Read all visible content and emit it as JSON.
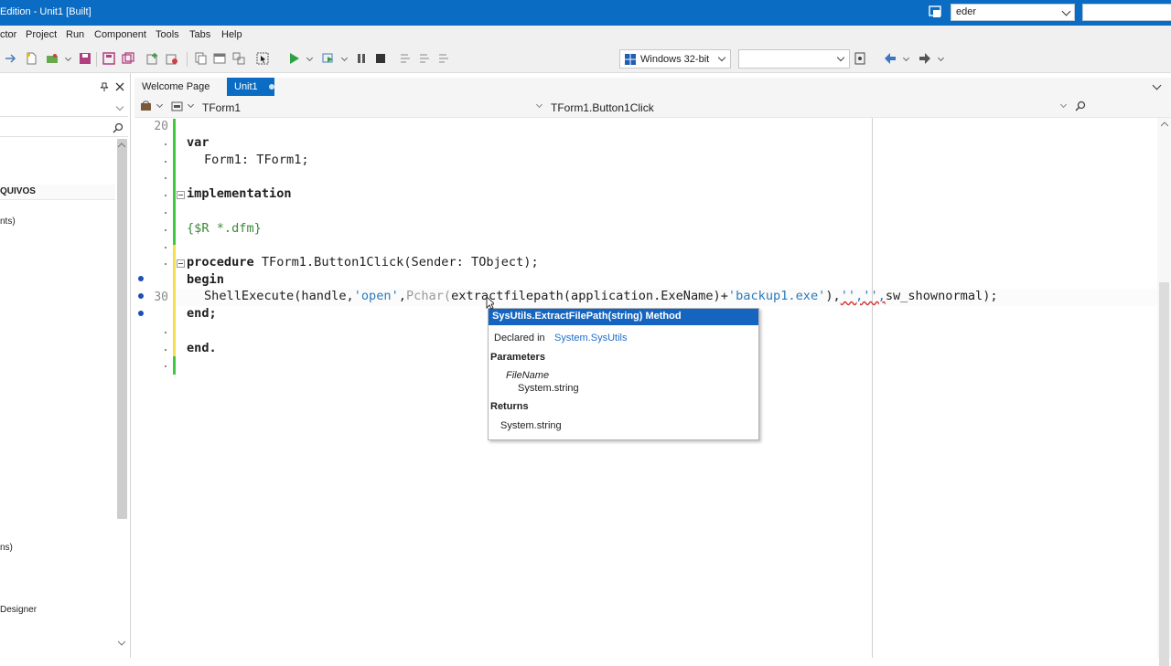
{
  "window": {
    "title": "Edition - Unit1 [Built]",
    "user_combo": "eder",
    "right_combo": ""
  },
  "menu": [
    "ctor",
    "Project",
    "Run",
    "Component",
    "Tools",
    "Tabs",
    "Help"
  ],
  "toolbar": {
    "platform": "Windows 32-bit",
    "config": ""
  },
  "left_panel": {
    "items": [
      "QUIVOS",
      "nts)",
      "ns)",
      "Designer"
    ]
  },
  "tabs": [
    {
      "label": "Welcome Page",
      "active": false
    },
    {
      "label": "Unit1",
      "active": true,
      "modified": true
    }
  ],
  "navigator": {
    "class": "TForm1",
    "method": "TForm1.Button1Click"
  },
  "editor": {
    "line_20": "20",
    "line_30": "30",
    "l_var": "var",
    "l_form1": "Form1: TForm1;",
    "l_impl": "implementation",
    "l_res": "{$R *.dfm}",
    "l_proc_kw": "procedure",
    "l_proc_rest": " TForm1.Button1Click(Sender: TObject);",
    "l_begin": "begin",
    "l_shell_a": "ShellExecute(handle,",
    "l_shell_open": "'open'",
    "l_shell_b": ",",
    "l_shell_pchar": "Pchar(",
    "l_shell_c": "extractfilepath(application.ExeName)+",
    "l_shell_exe": "'backup1.exe'",
    "l_shell_d": "),",
    "l_shell_e": "'','',",
    "l_shell_f": "sw_shownormal);",
    "l_end_semi": "end;",
    "l_end_dot": "end."
  },
  "tooltip": {
    "header": "SysUtils.ExtractFilePath(string) Method",
    "declared_label": "Declared in",
    "declared_link": "System.SysUtils",
    "params_label": "Parameters",
    "param_name": "FileName",
    "param_type": "System.string",
    "returns_label": "Returns",
    "returns_type": "System.string"
  },
  "colors": {
    "accent": "#0a6cc2",
    "change_bar_green": "#3ec93e",
    "change_bar_yellow": "#f4e04d"
  }
}
